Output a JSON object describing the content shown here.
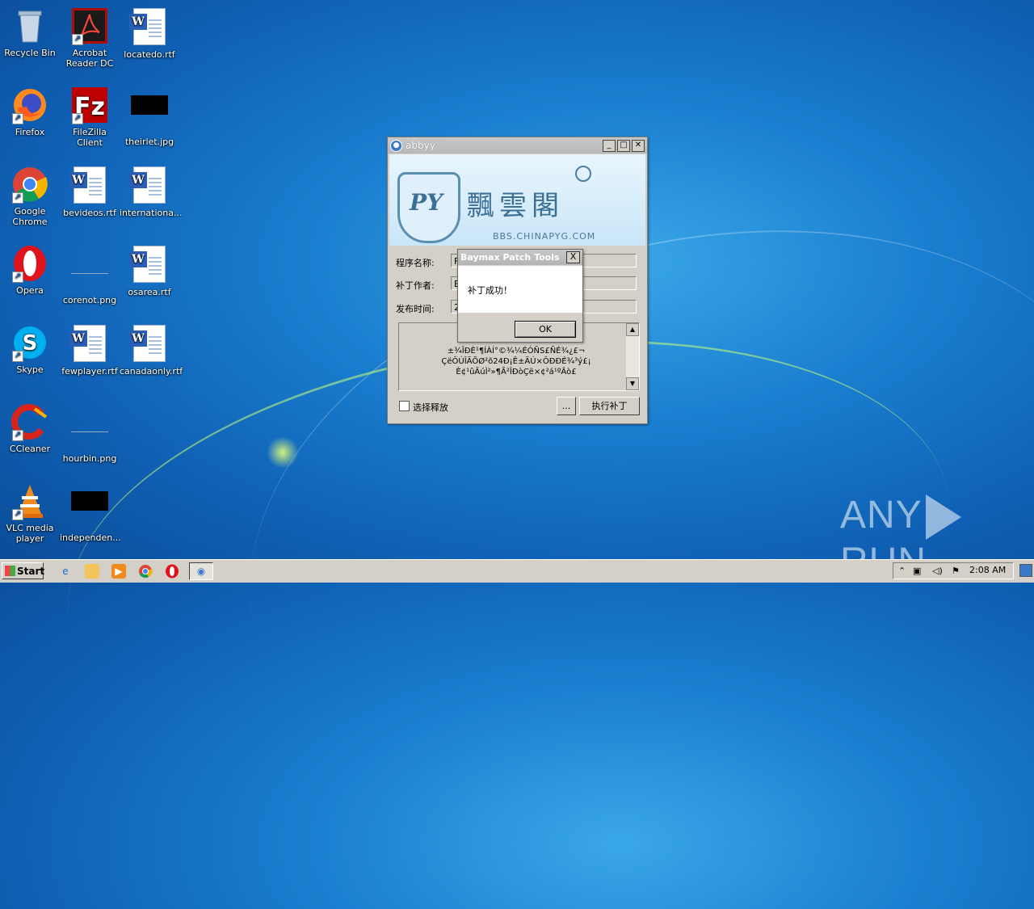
{
  "desktop": {
    "icons": [
      {
        "label": "Recycle Bin"
      },
      {
        "label": "Acrobat Reader DC"
      },
      {
        "label": "locatedo.rtf"
      },
      {
        "label": "Firefox"
      },
      {
        "label": "FileZilla Client"
      },
      {
        "label": "theirlet.jpg"
      },
      {
        "label": "Google Chrome"
      },
      {
        "label": "bevideos.rtf"
      },
      {
        "label": "internationa..."
      },
      {
        "label": "Opera"
      },
      {
        "label": "corenot.png"
      },
      {
        "label": "osarea.rtf"
      },
      {
        "label": "Skype"
      },
      {
        "label": "fewplayer.rtf"
      },
      {
        "label": "canadaonly.rtf"
      },
      {
        "label": "CCleaner"
      },
      {
        "label": "hourbin.png"
      },
      {
        "label": "VLC media player"
      },
      {
        "label": "independen..."
      }
    ]
  },
  "main_window": {
    "title": "abbyy",
    "banner": {
      "chinese_title": "飄雲閣",
      "url": "BBS.CHINAPYG.COM",
      "logo_text": "PY"
    },
    "fields": [
      {
        "label": "程序名称:",
        "value": "F"
      },
      {
        "label": "补丁作者:",
        "value": "E"
      },
      {
        "label": "发布时间:",
        "value": "2"
      }
    ],
    "garbled_text": [
      "±¾ÎÐÈ¹¶ÍÀÍ°©¾¼ÉÓÑS£ÑÉ¾¿£¬",
      "ÇëÔÚÎÄÕØ²õ24Ð¡Ê±ÄÚ×ÔÐÐÉ¾³ý£¡",
      "È¢¹ûÄúÌ²»¶Ã²ÎÐòÇë×¢²á¹ºÂò£"
    ],
    "checkbox_label": "选择释放",
    "browse_button": "...",
    "execute_button": "执行补丁"
  },
  "message_box": {
    "title": "Baymax Patch Tools",
    "message": "补丁成功！",
    "ok_button": "OK",
    "close_glyph": "X"
  },
  "watermark": {
    "left": "ANY",
    "right": "RUN"
  },
  "taskbar": {
    "start_label": "Start",
    "clock": "2:08 AM"
  }
}
